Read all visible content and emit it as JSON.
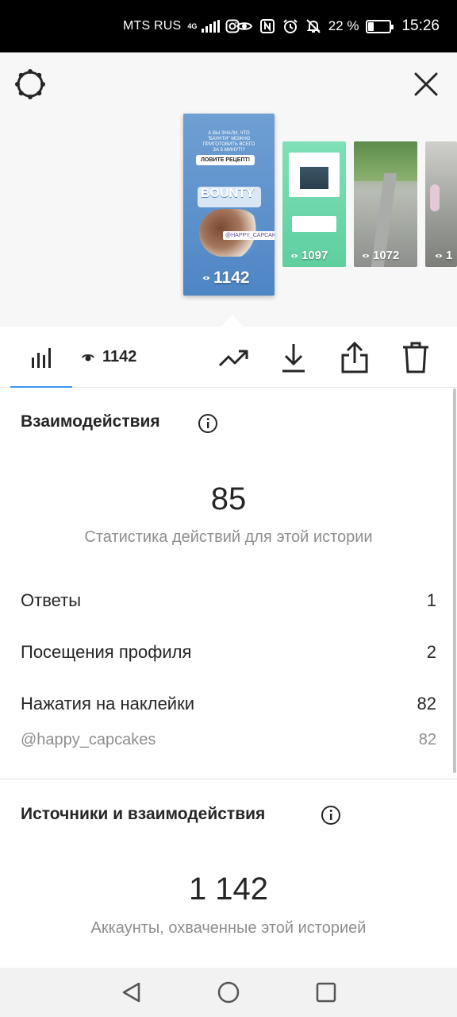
{
  "status_bar": {
    "carrier": "MTS RUS",
    "network": "4G",
    "battery": "22 %",
    "time": "15:26",
    "battery_level": 0.22,
    "icons": [
      "instagram-icon",
      "eye-icon",
      "nfc-icon",
      "alarm-icon",
      "bell-off-icon"
    ]
  },
  "header": {
    "settings_icon": "gear-icon",
    "close_icon": "close-icon"
  },
  "stories": [
    {
      "views": "1142",
      "selected": true,
      "text_top": "А ВЫ ЗНАЛИ, ЧТО \"БАУНТИ\" МОЖНО ПРИГОТОВИТЬ ВСЕГО ЗА 5 МИНУТ!?",
      "sticker": "ЛОВИТЕ РЕЦЕПТ!",
      "mention": "@HAPPY_CAPCAKES",
      "brand": "BOUNTY"
    },
    {
      "views": "1097",
      "selected": false
    },
    {
      "views": "1072",
      "selected": false
    },
    {
      "views": "1",
      "selected": false
    }
  ],
  "toolbar": {
    "views": "1142",
    "actions": [
      "trending-icon",
      "download-icon",
      "share-icon",
      "trash-icon"
    ]
  },
  "interactions": {
    "title": "Взаимодействия",
    "total": "85",
    "subtitle": "Статистика действий для этой истории",
    "rows": [
      {
        "label": "Ответы",
        "value": "1"
      },
      {
        "label": "Посещения профиля",
        "value": "2"
      },
      {
        "label": "Нажатия на наклейки",
        "value": "82"
      }
    ],
    "sub_row": {
      "label": "@happy_capcakes",
      "value": "82"
    }
  },
  "sources": {
    "title": "Источники и взаимодействия",
    "total": "1 142",
    "subtitle": "Аккаунты, охваченные этой историей"
  },
  "colors": {
    "accent": "#3897f0",
    "text": "#262626",
    "muted": "#8e8e8e"
  }
}
